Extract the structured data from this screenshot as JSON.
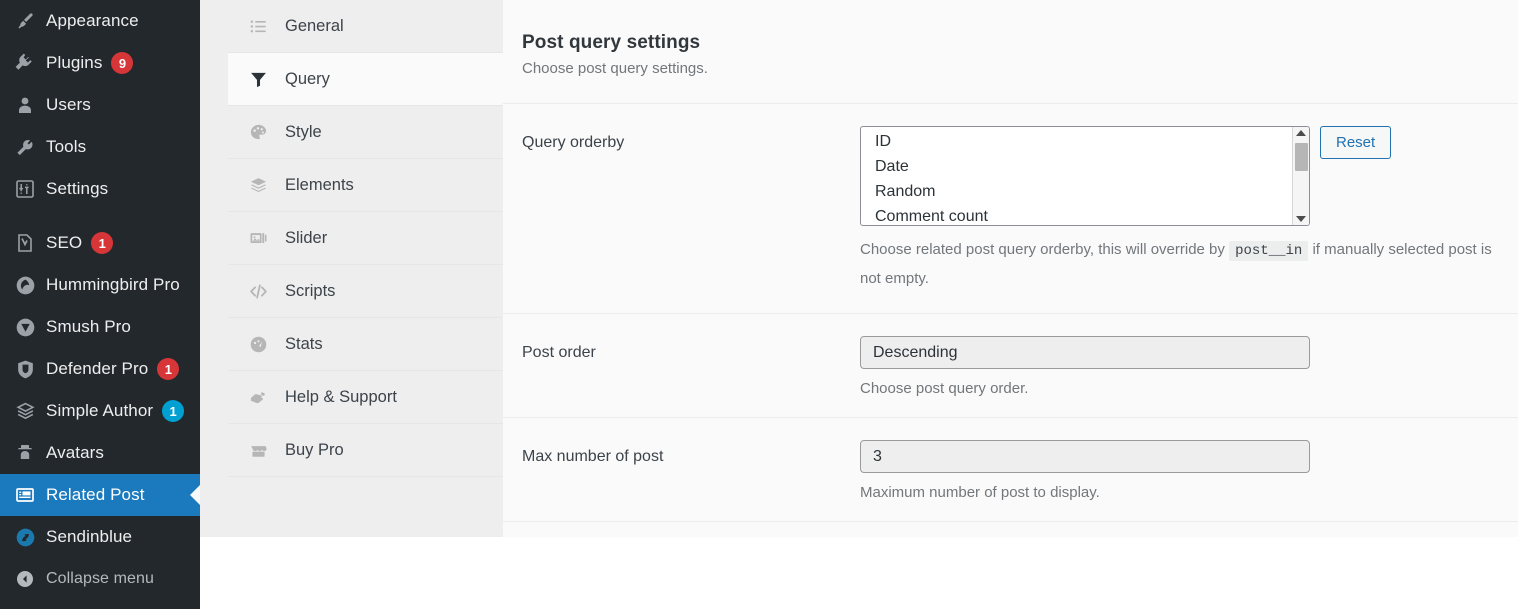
{
  "wp_sidebar": {
    "items": [
      {
        "label": "Appearance",
        "icon": "paintbrush-icon",
        "badge": null,
        "active": false
      },
      {
        "label": "Plugins",
        "icon": "plug-icon",
        "badge": "9",
        "badge_color": "#d63638",
        "active": false
      },
      {
        "label": "Users",
        "icon": "user-icon",
        "badge": null,
        "active": false
      },
      {
        "label": "Tools",
        "icon": "wrench-icon",
        "badge": null,
        "active": false
      },
      {
        "label": "Settings",
        "icon": "sliders-icon",
        "badge": null,
        "active": false
      },
      {
        "label": "SEO",
        "icon": "yoast-icon",
        "badge": "1",
        "badge_color": "#d63638",
        "active": false
      },
      {
        "label": "Hummingbird Pro",
        "icon": "hummingbird-icon",
        "badge": null,
        "active": false
      },
      {
        "label": "Smush Pro",
        "icon": "smush-icon",
        "badge": null,
        "active": false
      },
      {
        "label": "Defender Pro",
        "icon": "shield-icon",
        "badge": "1",
        "badge_color": "#d63638",
        "active": false
      },
      {
        "label": "Simple Author",
        "icon": "layers-icon",
        "badge": "1",
        "badge_color": "#00a0d2",
        "active": false
      },
      {
        "label": "Avatars",
        "icon": "avatar-icon",
        "badge": null,
        "active": false
      },
      {
        "label": "Related Post",
        "icon": "related-post-icon",
        "badge": null,
        "active": true
      },
      {
        "label": "Sendinblue",
        "icon": "sendinblue-icon",
        "badge": null,
        "active": false
      },
      {
        "label": "Collapse menu",
        "icon": "collapse-arrow-icon",
        "badge": null,
        "active": false
      }
    ],
    "active_color": "#1b79bd"
  },
  "tabs": [
    {
      "label": "General",
      "icon": "list-icon",
      "active": false
    },
    {
      "label": "Query",
      "icon": "funnel-icon",
      "active": true
    },
    {
      "label": "Style",
      "icon": "palette-icon",
      "active": false
    },
    {
      "label": "Elements",
      "icon": "layers-icon",
      "active": false
    },
    {
      "label": "Slider",
      "icon": "slider-images-icon",
      "active": false
    },
    {
      "label": "Scripts",
      "icon": "code-icon",
      "active": false
    },
    {
      "label": "Stats",
      "icon": "gauge-icon",
      "active": false
    },
    {
      "label": "Help & Support",
      "icon": "helping-hand-icon",
      "active": false
    },
    {
      "label": "Buy Pro",
      "icon": "store-icon",
      "active": false
    }
  ],
  "content": {
    "title": "Post query settings",
    "subtitle": "Choose post query settings.",
    "rows": {
      "query_orderby": {
        "label": "Query orderby",
        "options": [
          "ID",
          "Date",
          "Random",
          "Comment count"
        ],
        "reset_label": "Reset",
        "help_before": "Choose related post query orderby, this will override by",
        "help_code": "post__in",
        "help_after": "if manually selected post is not empty."
      },
      "post_order": {
        "label": "Post order",
        "value": "Descending",
        "help": "Choose post query order."
      },
      "max_posts": {
        "label": "Max number of post",
        "value": "3",
        "help": "Maximum number of post to display."
      }
    }
  }
}
